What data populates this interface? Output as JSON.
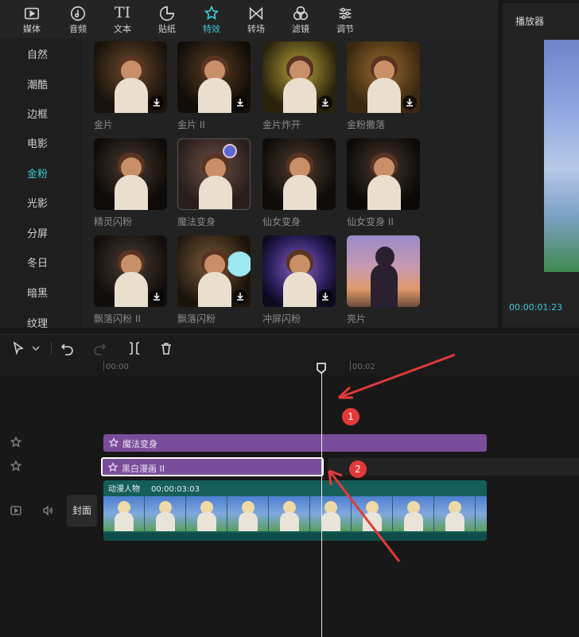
{
  "toolbar": {
    "items": [
      {
        "id": "media",
        "label": "媒体",
        "icon": "media-icon"
      },
      {
        "id": "audio",
        "label": "音频",
        "icon": "audio-icon"
      },
      {
        "id": "text",
        "label": "文本",
        "icon": "text-icon"
      },
      {
        "id": "sticker",
        "label": "贴纸",
        "icon": "sticker-icon"
      },
      {
        "id": "effects",
        "label": "特效",
        "icon": "effects-icon",
        "active": true
      },
      {
        "id": "transition",
        "label": "转场",
        "icon": "transition-icon"
      },
      {
        "id": "filter",
        "label": "滤镜",
        "icon": "filter-icon"
      },
      {
        "id": "adjust",
        "label": "调节",
        "icon": "adjust-icon"
      }
    ],
    "text_glyph": "TI"
  },
  "categories": [
    {
      "label": "自然"
    },
    {
      "label": "潮酷"
    },
    {
      "label": "边框"
    },
    {
      "label": "电影"
    },
    {
      "label": "金粉",
      "active": true
    },
    {
      "label": "光影"
    },
    {
      "label": "分屏"
    },
    {
      "label": "冬日"
    },
    {
      "label": "暗黑"
    },
    {
      "label": "纹理"
    }
  ],
  "effects": [
    {
      "name": "金片",
      "download": true
    },
    {
      "name": "金片 II",
      "download": true
    },
    {
      "name": "金片炸开",
      "download": true
    },
    {
      "name": "金粉撒落",
      "download": true
    },
    {
      "name": "精灵闪粉",
      "download": false
    },
    {
      "name": "魔法变身",
      "download": false
    },
    {
      "name": "仙女变身",
      "download": false
    },
    {
      "name": "仙女变身 II",
      "download": false
    },
    {
      "name": "飘落闪粉 II",
      "download": true
    },
    {
      "name": "飘落闪粉",
      "download": true
    },
    {
      "name": "冲屏闪粉",
      "download": true
    },
    {
      "name": "亮片",
      "download": false
    }
  ],
  "player": {
    "title": "播放器",
    "timecode": "00:00:01:23"
  },
  "timeline": {
    "ruler": {
      "start": "00:00",
      "mark": "00:02"
    },
    "effect_clips": [
      {
        "label": "魔法变身",
        "icon": "effect-clip-icon"
      },
      {
        "label": "黑白漫画 II",
        "icon": "effect-clip-icon",
        "selected": true
      }
    ],
    "main_clip": {
      "name": "动漫人物",
      "duration": "00:00:03:03"
    },
    "cover_label": "封面",
    "callouts": [
      "1",
      "2"
    ]
  },
  "colors": {
    "accent": "#3ec9d6",
    "effect_clip": "#7a4d9a",
    "main_clip": "#155e5a",
    "callout": "#e23a3a"
  }
}
